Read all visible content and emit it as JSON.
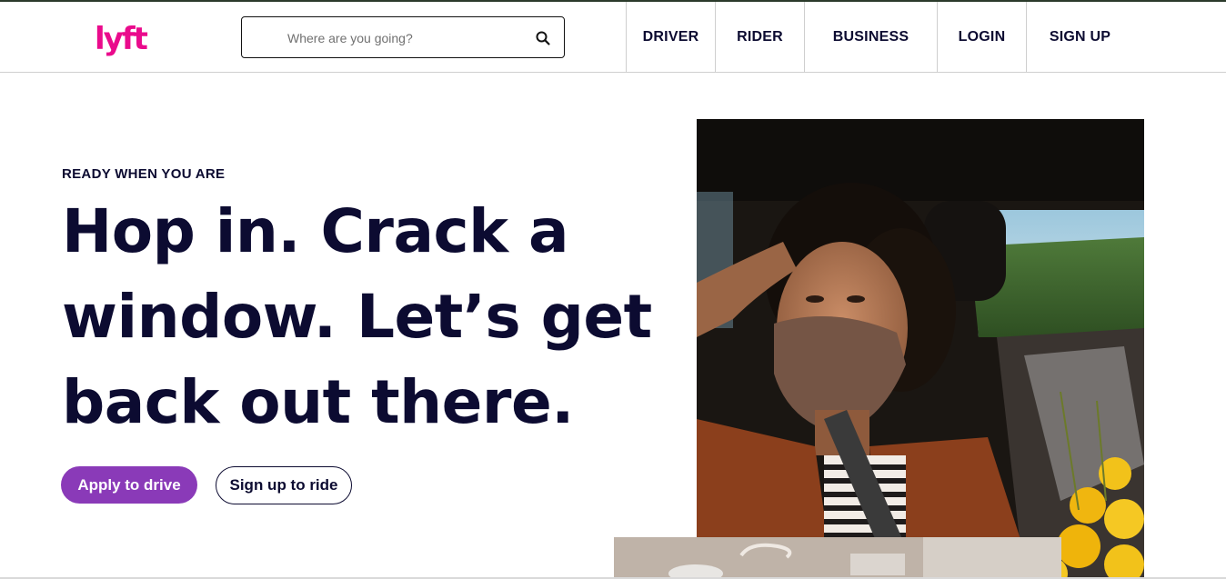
{
  "brand": {
    "logo_text": "lyft",
    "accent_color": "#ea0b8c"
  },
  "search": {
    "placeholder": "Where are you going?",
    "value": "",
    "icon": "search-icon"
  },
  "nav": {
    "items": [
      {
        "label": "DRIVER"
      },
      {
        "label": "RIDER"
      },
      {
        "label": "BUSINESS"
      },
      {
        "label": "LOGIN"
      },
      {
        "label": "SIGN UP"
      }
    ]
  },
  "hero": {
    "eyebrow": "READY WHEN YOU ARE",
    "headline_lines": [
      "Hop in. Crack a",
      "window. Let’s get",
      "back out there."
    ],
    "primary_cta": "Apply to drive",
    "secondary_cta": "Sign up to ride",
    "primary_color": "#8a3ab8"
  }
}
